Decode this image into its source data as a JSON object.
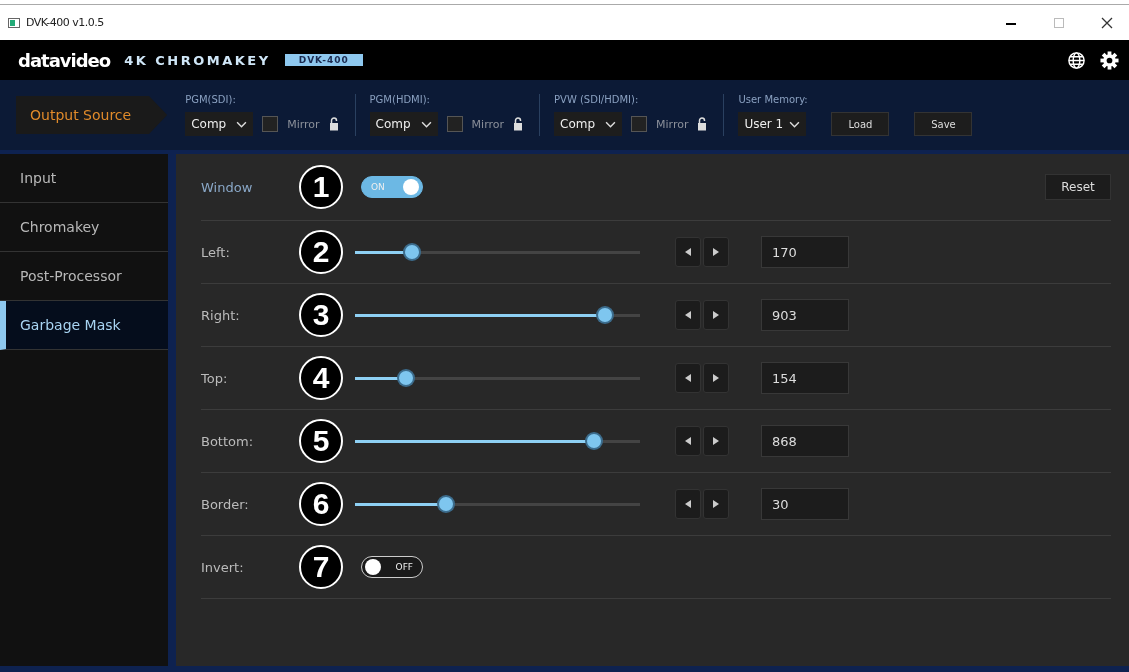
{
  "window": {
    "title": "DVK-400 v1.0.5"
  },
  "header": {
    "logo": "datavideo",
    "product": "4K CHROMAKEY",
    "model": "DVK-400"
  },
  "output_bar": {
    "label": "Output Source",
    "groups": [
      {
        "label": "PGM(SDI):",
        "value": "Comp",
        "mirror_label": "Mirror",
        "mirror_checked": false
      },
      {
        "label": "PGM(HDMI):",
        "value": "Comp",
        "mirror_label": "Mirror",
        "mirror_checked": false
      },
      {
        "label": "PVW (SDI/HDMI):",
        "value": "Comp",
        "mirror_label": "Mirror",
        "mirror_checked": false
      }
    ],
    "memory": {
      "label": "User Memory:",
      "value": "User 1",
      "buttons": [
        "Load",
        "Save"
      ]
    }
  },
  "sidebar": {
    "items": [
      {
        "label": "Input",
        "selected": false
      },
      {
        "label": "Chromakey",
        "selected": false
      },
      {
        "label": "Post-Processor",
        "selected": false
      },
      {
        "label": "Garbage Mask",
        "selected": true
      }
    ]
  },
  "panel": {
    "reset": "Reset",
    "rows": [
      {
        "kind": "toggle",
        "label": "Window",
        "callout": "1",
        "on": true,
        "toggle_text": "ON"
      },
      {
        "kind": "slider",
        "label": "Left:",
        "callout": "2",
        "level": 0.2,
        "value": "170"
      },
      {
        "kind": "slider",
        "label": "Right:",
        "callout": "3",
        "level": 0.877,
        "value": "903"
      },
      {
        "kind": "slider",
        "label": "Top:",
        "callout": "4",
        "level": 0.18,
        "value": "154"
      },
      {
        "kind": "slider",
        "label": "Bottom:",
        "callout": "5",
        "level": 0.84,
        "value": "868"
      },
      {
        "kind": "slider",
        "label": "Border:",
        "callout": "6",
        "level": 0.32,
        "value": "30"
      },
      {
        "kind": "toggle",
        "label": "Invert:",
        "callout": "7",
        "on": false,
        "toggle_text": "OFF"
      }
    ]
  }
}
